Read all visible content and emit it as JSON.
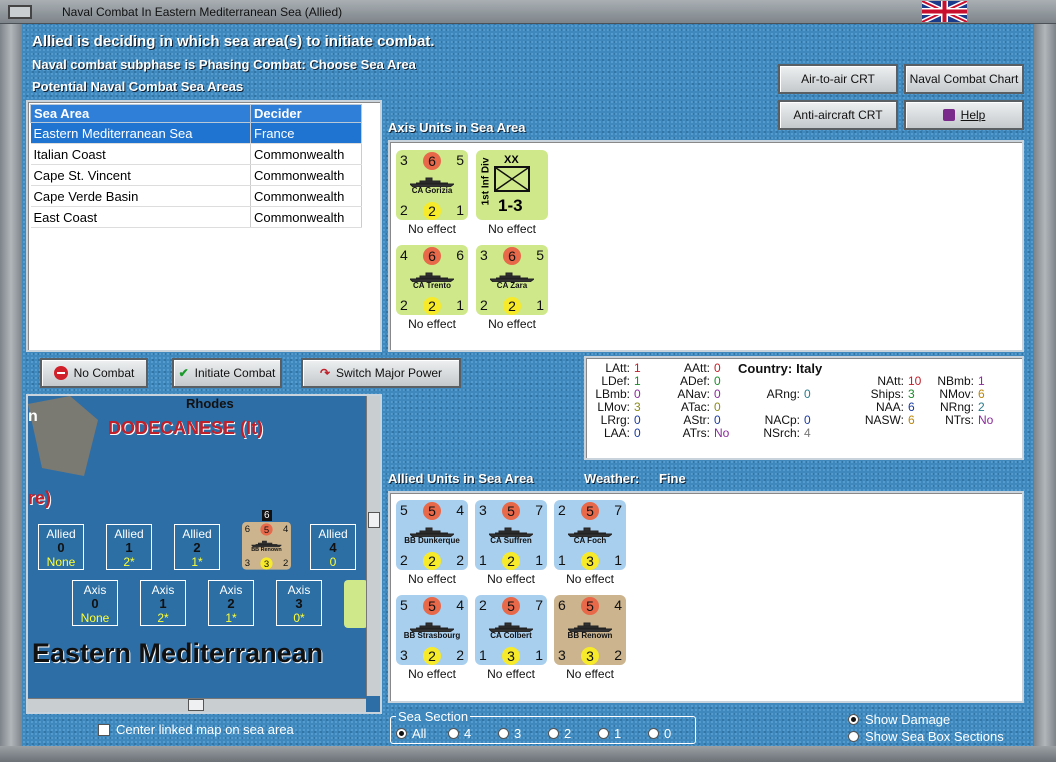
{
  "window": {
    "title": "Naval Combat In Eastern Mediterranean Sea (Allied)"
  },
  "header": {
    "line1": "Allied is deciding in which sea area(s) to initiate combat.",
    "line2": "Naval combat subphase is Phasing Combat: Choose Sea Area",
    "line3": "Potential Naval Combat Sea Areas"
  },
  "buttons": {
    "air_crt": "Air-to-air CRT",
    "naval_chart": "Naval Combat Chart",
    "aa_crt": "Anti-aircraft CRT",
    "help": "Help",
    "no_combat": "No Combat",
    "initiate": "Initiate Combat",
    "switch": "Switch Major Power"
  },
  "sea_table": {
    "col1": "Sea Area",
    "col2": "Decider",
    "rows": [
      {
        "area": "Eastern Mediterranean Sea",
        "decider": "France"
      },
      {
        "area": "Italian Coast",
        "decider": "Commonwealth"
      },
      {
        "area": "Cape St. Vincent",
        "decider": "Commonwealth"
      },
      {
        "area": "Cape Verde Basin",
        "decider": "Commonwealth"
      },
      {
        "area": "East Coast",
        "decider": "Commonwealth"
      }
    ]
  },
  "axis": {
    "heading": "Axis Units in Sea Area",
    "units": [
      {
        "name": "CA Gorizia",
        "tl": "3",
        "tc": "6",
        "tr": "5",
        "bl": "2",
        "bc": "2",
        "br": "1",
        "effect": "No effect"
      },
      {
        "name": "1st Inf Div",
        "size": "XX",
        "value": "1-3",
        "effect": "No effect"
      },
      {
        "name": "CA Trento",
        "tl": "4",
        "tc": "6",
        "tr": "6",
        "bl": "2",
        "bc": "2",
        "br": "1",
        "effect": "No effect"
      },
      {
        "name": "CA Zara",
        "tl": "3",
        "tc": "6",
        "tr": "5",
        "bl": "2",
        "bc": "2",
        "br": "1",
        "effect": "No effect"
      }
    ]
  },
  "stats": {
    "country_label": "Country:",
    "country": "Italy",
    "col1": [
      [
        "LAtt:",
        "1"
      ],
      [
        "LDef:",
        "1"
      ],
      [
        "LBmb:",
        "0"
      ],
      [
        "LMov:",
        "3"
      ],
      [
        "LRrg:",
        "0"
      ],
      [
        "LAA:",
        "0"
      ]
    ],
    "col2": [
      [
        "AAtt:",
        "0"
      ],
      [
        "ADef:",
        "0"
      ],
      [
        "ANav:",
        "0"
      ],
      [
        "ATac:",
        "0"
      ],
      [
        "AStr:",
        "0"
      ],
      [
        "ATrs:",
        "No"
      ]
    ],
    "col3": [
      [
        "ARng:",
        "0"
      ],
      [
        "NACp:",
        "0"
      ],
      [
        "NSrch:",
        "4"
      ]
    ],
    "col4": [
      [
        "NAtt:",
        "10"
      ],
      [
        "Ships:",
        "3"
      ],
      [
        "NAA:",
        "6"
      ],
      [
        "NASW:",
        "6"
      ]
    ],
    "col5": [
      [
        "NBmb:",
        "1"
      ],
      [
        "NMov:",
        "6"
      ],
      [
        "NRng:",
        "2"
      ],
      [
        "NTrs:",
        "No"
      ]
    ]
  },
  "allied": {
    "heading": "Allied Units in Sea Area",
    "weather_label": "Weather:",
    "weather": "Fine",
    "units": [
      {
        "name": "BB Dunkerque",
        "tl": "5",
        "tc": "5",
        "tr": "4",
        "bl": "2",
        "bc": "2",
        "br": "2",
        "effect": "No effect"
      },
      {
        "name": "CA Suffren",
        "tl": "3",
        "tc": "5",
        "tr": "7",
        "bl": "1",
        "bc": "2",
        "br": "1",
        "effect": "No effect"
      },
      {
        "name": "CA Foch",
        "tl": "2",
        "tc": "5",
        "tr": "7",
        "bl": "1",
        "bc": "3",
        "br": "1",
        "effect": "No effect"
      },
      {
        "name": "BB Strasbourg",
        "tl": "5",
        "tc": "5",
        "tr": "4",
        "bl": "3",
        "bc": "2",
        "br": "2",
        "effect": "No effect"
      },
      {
        "name": "CA Colbert",
        "tl": "2",
        "tc": "5",
        "tr": "7",
        "bl": "1",
        "bc": "3",
        "br": "1",
        "effect": "No effect"
      },
      {
        "name": "BB Renown",
        "tl": "6",
        "tc": "5",
        "tr": "4",
        "bl": "3",
        "bc": "3",
        "br": "2",
        "effect": "No effect"
      }
    ]
  },
  "map": {
    "rhodes": "Rhodes",
    "dodecanese": "DODECANESE (It)",
    "frag_n": "n",
    "frag_re": "re)",
    "sea_name": "Eastern Mediterranean",
    "allied_boxes": [
      {
        "t": "Allied",
        "n": "0",
        "v": "None"
      },
      {
        "t": "Allied",
        "n": "1",
        "v": "2*"
      },
      {
        "t": "Allied",
        "n": "2",
        "v": "1*"
      },
      {
        "t": "Allied",
        "n": "4",
        "v": "0"
      }
    ],
    "axis_boxes": [
      {
        "t": "Axis",
        "n": "0",
        "v": "None"
      },
      {
        "t": "Axis",
        "n": "1",
        "v": "2*"
      },
      {
        "t": "Axis",
        "n": "2",
        "v": "1*"
      },
      {
        "t": "Axis",
        "n": "3",
        "v": "0*"
      }
    ],
    "renown_stack": "6",
    "renown": {
      "name": "BB Renown",
      "tl": "6",
      "tc": "5",
      "tr": "4",
      "bl": "3",
      "bc": "3",
      "br": "2"
    },
    "center_label": "Center linked map on sea area"
  },
  "sea_section": {
    "label": "Sea Section",
    "options": [
      "All",
      "4",
      "3",
      "2",
      "1",
      "0"
    ],
    "selected": "All"
  },
  "display": {
    "damage": "Show Damage",
    "sections": "Show Sea Box Sections"
  }
}
